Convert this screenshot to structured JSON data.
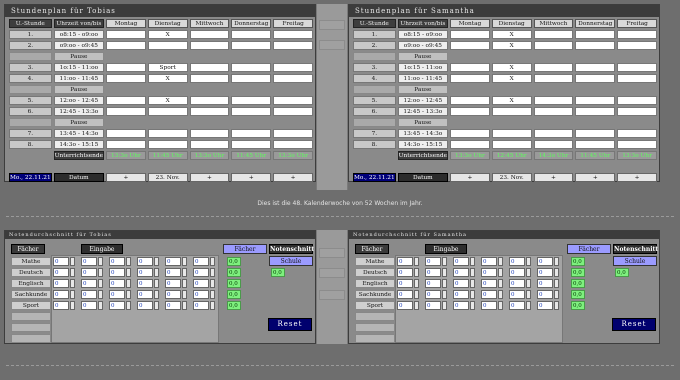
{
  "left": {
    "title": "Stundenplan für Tobias",
    "rows": [
      {
        "num": "1.",
        "time": "o8:15 - o9:oo",
        "cells": [
          "",
          "X",
          "",
          "",
          ""
        ]
      },
      {
        "num": "2.",
        "time": "o9:oo - o9:45",
        "cells": [
          "",
          "",
          "",
          "",
          ""
        ]
      },
      {
        "pause": "Pause"
      },
      {
        "num": "3.",
        "time": "1o:15 - 11:oo",
        "cells": [
          "",
          "Sport",
          "",
          "",
          ""
        ]
      },
      {
        "num": "4.",
        "time": "11:oo - 11:45",
        "cells": [
          "",
          "X",
          "",
          "",
          ""
        ]
      },
      {
        "pause": "Pause"
      },
      {
        "num": "5.",
        "time": "12:oo - 12:45",
        "cells": [
          "",
          "X",
          "",
          "",
          ""
        ]
      },
      {
        "num": "6.",
        "time": "12:45 - 13:3o",
        "cells": [
          "",
          "",
          "",
          "",
          ""
        ]
      },
      {
        "pause": "Pause"
      },
      {
        "num": "7.",
        "time": "13:45 - 14:3o",
        "cells": [
          "",
          "",
          "",
          "",
          ""
        ]
      },
      {
        "num": "8.",
        "time": "14:3o - 15:15",
        "cells": [
          "",
          "",
          "",
          "",
          ""
        ]
      }
    ],
    "ende_times": [
      "13:3o Uhr",
      "11:45 Uhr",
      "13:3o Uhr",
      "11:45 Uhr",
      "13:3o Uhr"
    ],
    "date_btn": "Mo., 22.11.21",
    "date_cells": [
      "+",
      "23. Nov.",
      "+",
      "+",
      "+"
    ],
    "grades_title": "Notendurchschnitt für Tobias"
  },
  "right": {
    "title": "Stundenplan für Samantha",
    "rows": [
      {
        "num": "1.",
        "time": "o8:15 - o9:oo",
        "cells": [
          "",
          "X",
          "",
          "",
          ""
        ]
      },
      {
        "num": "2.",
        "time": "o9:oo - o9:45",
        "cells": [
          "",
          "X",
          "",
          "",
          ""
        ]
      },
      {
        "pause": "Pause"
      },
      {
        "num": "3.",
        "time": "1o:15 - 11:oo",
        "cells": [
          "",
          "X",
          "",
          "",
          ""
        ]
      },
      {
        "num": "4.",
        "time": "11:oo - 11:45",
        "cells": [
          "",
          "X",
          "",
          "",
          ""
        ]
      },
      {
        "pause": "Pause"
      },
      {
        "num": "5.",
        "time": "12:oo - 12:45",
        "cells": [
          "",
          "X",
          "",
          "",
          ""
        ]
      },
      {
        "num": "6.",
        "time": "12:45 - 13:3o",
        "cells": [
          "",
          "",
          "",
          "",
          ""
        ]
      },
      {
        "pause": "Pause"
      },
      {
        "num": "7.",
        "time": "13:45 - 14:3o",
        "cells": [
          "",
          "",
          "",
          "",
          ""
        ]
      },
      {
        "num": "8.",
        "time": "14:3o - 15:15",
        "cells": [
          "",
          "",
          "",
          "",
          ""
        ]
      }
    ],
    "ende_times": [
      "13:3o Uhr",
      "12:45 Uhr",
      "14:3o Uhr",
      "11:45 Uhr",
      "13:3o Uhr"
    ],
    "date_btn": "Mo., 22.11.21",
    "date_cells": [
      "+",
      "23. Nov.",
      "+",
      "+",
      "+"
    ],
    "grades_title": "Notendurchschnitt für Samantha"
  },
  "headers": {
    "stunde": "U.-Stunde",
    "uhrzeit": "Uhrzeit von/bis",
    "days": [
      "Montag",
      "Dienstag",
      "Mittwoch",
      "Donnerstag",
      "Freitag"
    ],
    "ende": "Unterrichtsende",
    "datum": "Datum"
  },
  "info": "Dies ist die 48. Kalenderwoche von 52 Wochen im Jahr.",
  "grades": {
    "faecher_label": "Fächer",
    "eingabe_label": "Eingabe",
    "subjects": [
      "Mathe",
      "Deutsch",
      "Englisch",
      "Sachkunde",
      "Sport"
    ],
    "input_value": "0",
    "avg_values": [
      "0,0",
      "0,0",
      "0,0",
      "0,0",
      "0,0"
    ],
    "faecher_btn": "Fächer",
    "notenschnitt_label": "Notenschnitt",
    "schule_btn": "Schule",
    "schule_avg": "0,0",
    "reset": "Reset"
  },
  "colors": {
    "accent": "#00007a",
    "green": "#5cff5c",
    "header": "#3c3c3c"
  }
}
